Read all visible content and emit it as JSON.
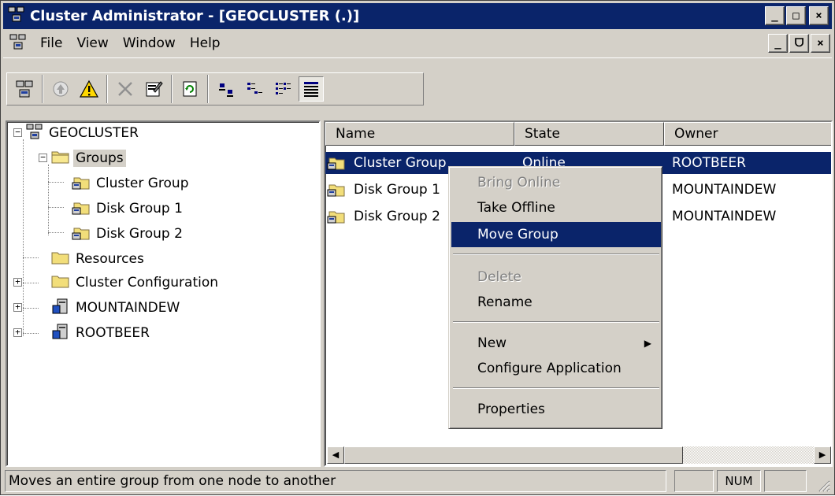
{
  "window": {
    "title": "Cluster Administrator - [GEOCLUSTER (.)]",
    "buttons": {
      "minimize": "_",
      "maximize": "□",
      "close": "×",
      "restore": "ᗜ"
    }
  },
  "menubar": {
    "items": [
      "File",
      "View",
      "Window",
      "Help"
    ]
  },
  "toolbar": {
    "buttons": [
      "cluster-icon",
      "bring-online-icon",
      "warning-icon",
      "delete-icon",
      "properties-icon",
      "refresh-icon",
      "large-icons-view-icon",
      "small-icons-view-icon",
      "list-view-icon",
      "details-view-icon"
    ]
  },
  "tree": {
    "root": "GEOCLUSTER",
    "groups": "Groups",
    "group_items": [
      "Cluster Group",
      "Disk Group 1",
      "Disk Group 2"
    ],
    "resources": "Resources",
    "cluster_configuration": "Cluster Configuration",
    "nodes": [
      "MOUNTAINDEW",
      "ROOTBEER"
    ],
    "expand_glyph": "+",
    "collapse_glyph": "−"
  },
  "list": {
    "columns": [
      "Name",
      "State",
      "Owner"
    ],
    "rows": [
      {
        "name": "Cluster Group",
        "state": "Online",
        "owner": "ROOTBEER"
      },
      {
        "name": "Disk Group 1",
        "state": "",
        "owner": "MOUNTAINDEW"
      },
      {
        "name": "Disk Group 2",
        "state": "",
        "owner": "MOUNTAINDEW"
      }
    ],
    "scroll_left": "◀",
    "scroll_right": "▶"
  },
  "context_menu": {
    "items": {
      "bring_online": "Bring Online",
      "take_offline": "Take Offline",
      "move_group": "Move Group",
      "delete": "Delete",
      "rename": "Rename",
      "new": "New",
      "configure_application": "Configure Application",
      "properties": "Properties"
    },
    "submenu_arrow": "▶"
  },
  "statusbar": {
    "text": "Moves an entire group from one node to another",
    "num": "NUM"
  },
  "colors": {
    "titlebar": "#0a246a",
    "selection": "#0a246a",
    "face": "#d4d0c8",
    "folder": "#f2de7a"
  }
}
